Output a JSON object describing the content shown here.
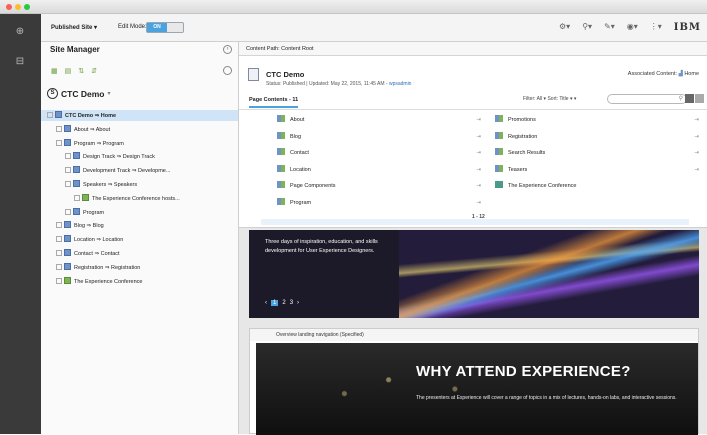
{
  "toolbar": {
    "published_site": "Published Site",
    "edit_mode_label": "Edit Mode:",
    "edit_mode_state": "ON",
    "brand": "IBM"
  },
  "site_manager": {
    "title": "Site Manager",
    "site_name": "CTC Demo",
    "tree": [
      {
        "label": "CTC Demo ⇒ Home",
        "level": 0,
        "selected": true
      },
      {
        "label": "About ⇒ About",
        "level": 1
      },
      {
        "label": "Program ⇒ Program",
        "level": 1
      },
      {
        "label": "Design Track ⇒ Design Track",
        "level": 2
      },
      {
        "label": "Development Track ⇒ Developme...",
        "level": 2
      },
      {
        "label": "Speakers ⇒ Speakers",
        "level": 2
      },
      {
        "label": "The Experience Conference hosts...",
        "level": 3
      },
      {
        "label": "Program",
        "level": 2
      },
      {
        "label": "Blog ⇒ Blog",
        "level": 1
      },
      {
        "label": "Location ⇒ Location",
        "level": 1
      },
      {
        "label": "Contact ⇒ Contact",
        "level": 1
      },
      {
        "label": "Registration ⇒ Registration",
        "level": 1
      },
      {
        "label": "The Experience Conference",
        "level": 1
      }
    ]
  },
  "content": {
    "path": "Content Path: Content Root",
    "title": "CTC Demo",
    "status": "Status: Published  |  Updated: May 22, 2015, 11:45 AM - ",
    "updated_by": "wpsadmin",
    "associated": "Associated Content:",
    "associated_target": "Home",
    "tab": "Page Contents - 11",
    "filter": "Filter: All ▾   Sort: Title ▾ ▾",
    "left_items": [
      "About",
      "Blog",
      "Contact",
      "Location",
      "Page Components",
      "Program"
    ],
    "right_items": [
      "Promotions",
      "Registration",
      "Search Results",
      "Teasers",
      "The Experience Conference"
    ],
    "pager": "1 - 12"
  },
  "preview": {
    "banner_text": "Three days of inspiration, education, and skills development for User Experience Designers.",
    "pages": [
      "1",
      "2",
      "3"
    ],
    "landing_label": "Overview landing navigation (Specified)",
    "landing_title": "WHY ATTEND EXPERIENCE?",
    "landing_desc": "The presenters at Experience will cover a range of topics in a mix of lectures, hands-on labs, and interactive sessions."
  }
}
